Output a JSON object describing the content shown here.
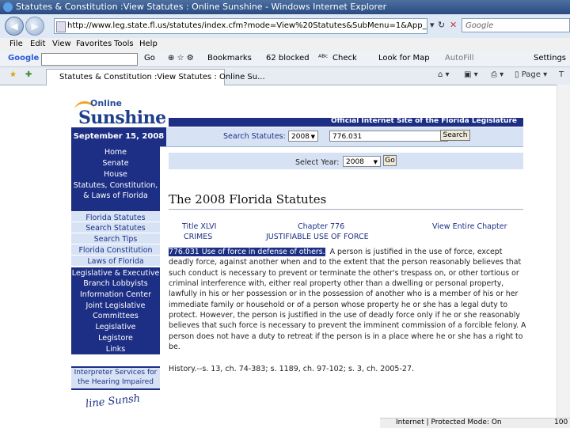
{
  "browser": {
    "window_title": "Statutes & Constitution :View Statutes : Online Sunshine - Windows Internet Explorer",
    "url": "http://www.leg.state.fl.us/statutes/index.cfm?mode=View%20Statutes&SubMenu=1&App_mode=Display_Stat",
    "search_placeholder": "Google",
    "menu": [
      "File",
      "Edit",
      "View",
      "Favorites",
      "Tools",
      "Help"
    ],
    "google_toolbar": {
      "label": "Google",
      "go": "Go",
      "bookmarks": "Bookmarks",
      "blocked": "62 blocked",
      "check": "Check",
      "look_for_map": "Look for Map",
      "autofill": "AutoFill",
      "settings": "Settings"
    },
    "tab_title": "Statutes & Constitution :View Statutes : Online Su...",
    "tab_tools": {
      "page": "Page",
      "tools": "T"
    },
    "status": {
      "zone": "Internet | Protected Mode: On",
      "zoom": "100"
    }
  },
  "site": {
    "logo_small": "Online",
    "logo_big": "Sunshine",
    "official_banner": "Official Internet Site of the Florida Legislature",
    "date": "September 15, 2008",
    "search_label": "Search Statutes:",
    "search_year": "2008",
    "search_value": "776.031",
    "search_button": "Search",
    "select_year_label": "Select Year:",
    "select_year_value": "2008",
    "go_button": "Go"
  },
  "sidebar": {
    "items": [
      {
        "label": "Home",
        "style": "dark"
      },
      {
        "label": "Senate",
        "style": "dark"
      },
      {
        "label": "House",
        "style": "dark"
      },
      {
        "label": "Statutes, Constitution, & Laws of Florida",
        "style": "dark"
      },
      {
        "label": "Florida Statutes",
        "style": "light"
      },
      {
        "label": "Search Statutes",
        "style": "light"
      },
      {
        "label": "Search Tips",
        "style": "light"
      },
      {
        "label": "Florida Constitution",
        "style": "light"
      },
      {
        "label": "Laws of Florida",
        "style": "light"
      },
      {
        "label": "Legislative & Executive Branch Lobbyists",
        "style": "dark"
      },
      {
        "label": "Information Center",
        "style": "dark"
      },
      {
        "label": "Joint Legislative Committees",
        "style": "dark"
      },
      {
        "label": "Legislative Employment",
        "style": "dark"
      },
      {
        "label": "Legistore",
        "style": "dark"
      },
      {
        "label": "Links",
        "style": "dark"
      }
    ],
    "interpreter": "Interpreter Services for the Hearing Impaired"
  },
  "statute": {
    "heading": "The 2008 Florida Statutes",
    "title": "Title XLVI",
    "title_sub": "CRIMES",
    "chapter": "Chapter 776",
    "chapter_sub": "JUSTIFIABLE USE OF FORCE",
    "view_chapter": "View Entire Chapter",
    "section_label": "776.031  Use of force in defense of others.",
    "text": "A person is justified in the use of force, except deadly force, against another when and to the extent that the person reasonably believes that such conduct is necessary to prevent or terminate the other's trespass on, or other tortious or criminal interference with, either real property other than a dwelling or personal property, lawfully in his or her possession or in the possession of another who is a member of his or her immediate family or household or of a person whose property he or she has a legal duty to protect. However, the person is justified in the use of deadly force only if he or she reasonably believes that such force is necessary to prevent the imminent commission of a forcible felony. A person does not have a duty to retreat if the person is in a place where he or she has a right to be.",
    "history": "History.--s. 13, ch. 74-383; s. 1189, ch. 97-102; s. 3, ch. 2005-27."
  }
}
